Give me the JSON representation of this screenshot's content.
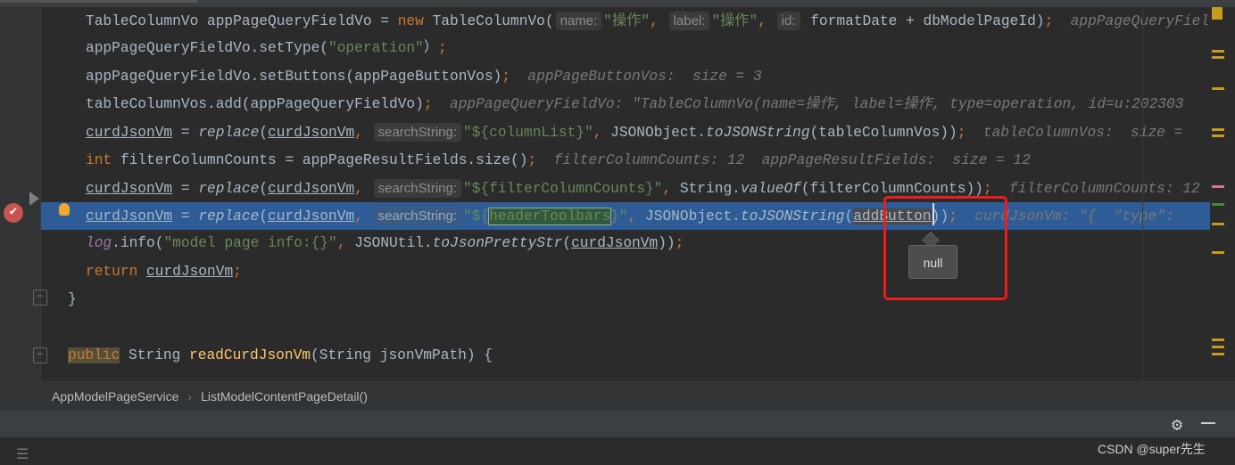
{
  "editor": {
    "lines": [
      {
        "tokens": [
          [
            "",
            "TableColumnVo appPageQueryFieldVo = "
          ],
          [
            "kw",
            "new"
          ],
          [
            "",
            " TableColumnVo("
          ],
          [
            "ph",
            "name:"
          ],
          [
            "str",
            "\"操作\""
          ],
          [
            "kw",
            ", "
          ],
          [
            "ph",
            "label:"
          ],
          [
            "str",
            "\"操作\""
          ],
          [
            "kw",
            ", "
          ],
          [
            "ph",
            "id:"
          ],
          [
            "",
            " formatDate + dbModelPageId)"
          ],
          [
            "kw",
            ";"
          ],
          [
            "hint",
            "  appPageQueryFieldVo: "
          ]
        ]
      },
      {
        "tokens": [
          [
            "",
            "appPageQueryFieldVo.setType("
          ],
          [
            "str",
            "\"operation\""
          ],
          [
            "",
            "）"
          ],
          [
            "kw",
            ";"
          ]
        ]
      },
      {
        "tokens": [
          [
            "",
            "appPageQueryFieldVo.setButtons(appPageButtonVos)"
          ],
          [
            "kw",
            ";"
          ],
          [
            "hint",
            "  appPageButtonVos:  size = 3"
          ]
        ]
      },
      {
        "tokens": [
          [
            "",
            "tableColumnVos.add(appPageQueryFieldVo)"
          ],
          [
            "kw",
            ";"
          ],
          [
            "hint",
            "  appPageQueryFieldVo: \"TableColumnVo(name=操作, label=操作, type=operation, id=u:202303"
          ]
        ]
      },
      {
        "tokens": [
          [
            "u",
            "curdJsonVm"
          ],
          [
            "",
            " = "
          ],
          [
            "it",
            "replace"
          ],
          [
            "",
            "("
          ],
          [
            "u",
            "curdJsonVm"
          ],
          [
            "kw",
            ", "
          ],
          [
            "ph",
            "searchString:"
          ],
          [
            "str",
            "\"${columnList}\""
          ],
          [
            "kw",
            ", "
          ],
          [
            "",
            "JSONObject."
          ],
          [
            "it",
            "toJSONString"
          ],
          [
            "",
            "(tableColumnVos))"
          ],
          [
            "kw",
            ";"
          ],
          [
            "hint",
            "  tableColumnVos:  size = "
          ]
        ]
      },
      {
        "tokens": [
          [
            "kw",
            "int"
          ],
          [
            "",
            " filterColumnCounts = appPageResultFields.size()"
          ],
          [
            "kw",
            ";"
          ],
          [
            "hint",
            "  filterColumnCounts: 12  appPageResultFields:  size = 12"
          ]
        ]
      },
      {
        "tokens": [
          [
            "u",
            "curdJsonVm"
          ],
          [
            "",
            " = "
          ],
          [
            "it",
            "replace"
          ],
          [
            "",
            "("
          ],
          [
            "u",
            "curdJsonVm"
          ],
          [
            "kw",
            ", "
          ],
          [
            "ph",
            "searchString:"
          ],
          [
            "str",
            "\"${filterColumnCounts}\""
          ],
          [
            "kw",
            ", "
          ],
          [
            "",
            "String."
          ],
          [
            "it",
            "valueOf"
          ],
          [
            "",
            "(filterColumnCounts))"
          ],
          [
            "kw",
            ";"
          ],
          [
            "hint",
            "  filterColumnCounts: 12"
          ]
        ]
      },
      {
        "sel": true,
        "tokens": [
          [
            "u",
            "curdJsonVm"
          ],
          [
            "",
            " = "
          ],
          [
            "it",
            "replace"
          ],
          [
            "",
            "("
          ],
          [
            "u",
            "curdJsonVm"
          ],
          [
            "kw",
            ", "
          ],
          [
            "ph",
            "searchString:"
          ],
          [
            "str",
            "\"${"
          ],
          [
            "str selhl",
            "headerToolbars"
          ],
          [
            "str",
            "}\""
          ],
          [
            "kw",
            ", "
          ],
          [
            "",
            "JSONObject."
          ],
          [
            "it",
            "toJSONString"
          ],
          [
            "",
            "("
          ],
          [
            "u addb",
            "addButton"
          ],
          [
            "",
            "))"
          ],
          [
            "kw",
            ";"
          ],
          [
            "hint",
            "  curdJsonVm: \"{  \"type\": "
          ]
        ]
      },
      {
        "tokens": [
          [
            "log",
            "log"
          ],
          [
            "",
            ".info("
          ],
          [
            "str",
            "\"model page info:{}\""
          ],
          [
            "kw",
            ", "
          ],
          [
            "",
            "JSONUtil."
          ],
          [
            "it",
            "toJsonPrettyStr"
          ],
          [
            "",
            "("
          ],
          [
            "u",
            "curdJsonVm"
          ],
          [
            "",
            "))"
          ],
          [
            "kw",
            ";"
          ]
        ]
      },
      {
        "tokens": [
          [
            "kw",
            "return"
          ],
          [
            "",
            " "
          ],
          [
            "u",
            "curdJsonVm"
          ],
          [
            "kw",
            ";"
          ]
        ]
      },
      {
        "outdent": true,
        "tokens": [
          [
            "",
            "}"
          ]
        ]
      },
      {
        "tokens": []
      },
      {
        "outdent": true,
        "tokens": [
          [
            "kw pubhl",
            "public"
          ],
          [
            "",
            " String "
          ],
          [
            "decl",
            "readCurdJsonVm"
          ],
          [
            "",
            "(String jsonVmPath) {"
          ]
        ]
      }
    ],
    "tooltip": "null"
  },
  "breadcrumb": [
    "AppModelPageService",
    "ListModelContentPageDetail()"
  ],
  "watermark": "CSDN @super先生",
  "colors": {
    "background": "#2b2b2b",
    "keyword": "#cc7832",
    "string": "#6a8759",
    "selection": "#2d5c96",
    "breakpoint": "#c75450",
    "highlight-box": "#ee1c1c"
  }
}
